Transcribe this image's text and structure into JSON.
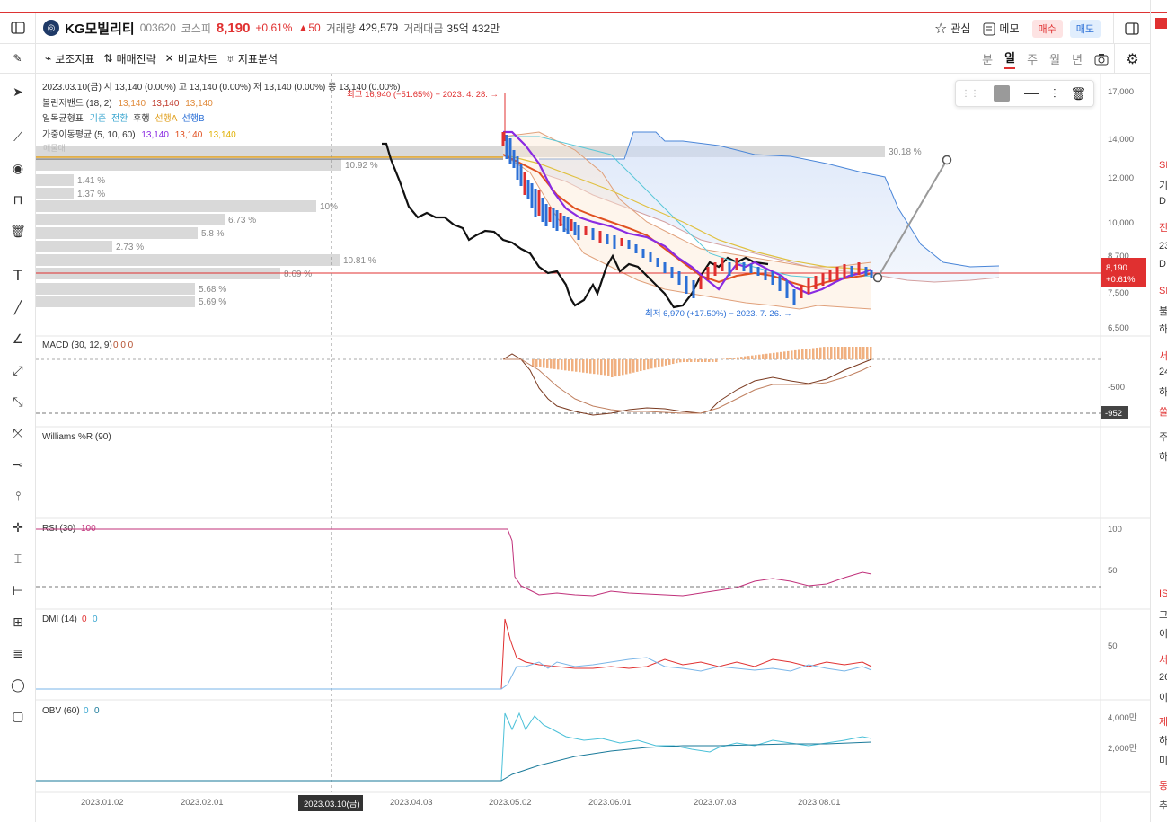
{
  "header": {
    "stock_name": "KG모빌리티",
    "stock_code": "003620",
    "market": "코스피",
    "price": "8,190",
    "change_pct": "+0.61%",
    "change_diff": "▲50",
    "volume_label": "거래량",
    "volume": "429,579",
    "amount_label": "거래대금",
    "amount": "35억 432만",
    "watch_label": "관심",
    "memo_label": "메모",
    "buy_label": "매수",
    "sell_label": "매도"
  },
  "toolbar": {
    "items": [
      "보조지표",
      "매매전략",
      "비교차트",
      "지표분석"
    ],
    "periods": [
      "분",
      "일",
      "주",
      "월",
      "년"
    ],
    "active_period": "일"
  },
  "legend": {
    "ohlc": "2023.03.10(금)  시 13,140 (0.00%)  고 13,140 (0.00%)  저 13,140 (0.00%)  종 13,140 (0.00%)",
    "bb_name": "볼린저밴드 (18, 2)",
    "bb_vals": [
      "13,140",
      "13,140",
      "13,140"
    ],
    "ichimoku_name": "일목균형표",
    "ichimoku_items": [
      "기준",
      "전환",
      "후행",
      "선행A",
      "선행B"
    ],
    "ma_name": "가중이동평균 (5, 10, 60)",
    "ma_vals": [
      "13,140",
      "13,140",
      "13,140"
    ],
    "max_label": "최고 16,940 (−51.65%) − 2023. 4. 28.",
    "min_label": "최저 6,970 (+17.50%) − 2023. 7. 26.",
    "volume_profile_title": "매물대"
  },
  "volume_profile": [
    "30.18 %",
    "10.92 %",
    "1.41 %",
    "1.37 %",
    "10%",
    "6.73 %",
    "5.8 %",
    "2.73 %",
    "10.81 %",
    "8.69 %",
    "5.68 %",
    "5.69 %"
  ],
  "price_axis": [
    "17,000",
    "14,000",
    "12,000",
    "10,000",
    "8,700",
    "7,500",
    "6,500"
  ],
  "price_tag": {
    "price": "8,190",
    "pct": "+0.61%"
  },
  "indicators": {
    "macd": {
      "label": "MACD (30, 12, 9)",
      "vals": [
        "0",
        "0",
        "0"
      ],
      "axis": [
        "-500"
      ],
      "tag": "-952"
    },
    "williams": {
      "label": "Williams %R (90)"
    },
    "rsi": {
      "label": "RSI (30)",
      "val": "100",
      "axis": [
        "100",
        "50"
      ]
    },
    "dmi": {
      "label": "DMI (14)",
      "vals": [
        "0",
        "0"
      ],
      "axis": [
        "50"
      ]
    },
    "obv": {
      "label": "OBV (60)",
      "vals": [
        "0",
        "0"
      ],
      "axis": [
        "4,000만",
        "2,000만"
      ]
    }
  },
  "date_axis": [
    "2023.01.02",
    "2023.02.01",
    "2023.03.10(금)",
    "2023.04.03",
    "2023.05.02",
    "2023.06.01",
    "2023.07.03",
    "2023.08.01"
  ],
  "right_panel": [
    "SK",
    "기",
    "D",
    "진",
    "23",
    "D",
    "SK",
    "불",
    "하",
    "서",
    "24",
    "하",
    "쏠",
    "주",
    "하",
    "IS",
    "고",
    "이",
    "서",
    "26",
    "이",
    "제",
    "하",
    "미",
    "동",
    "추"
  ],
  "colors": {
    "up": "#e03030",
    "down": "#2b6fd6",
    "accent": "#e03030"
  }
}
